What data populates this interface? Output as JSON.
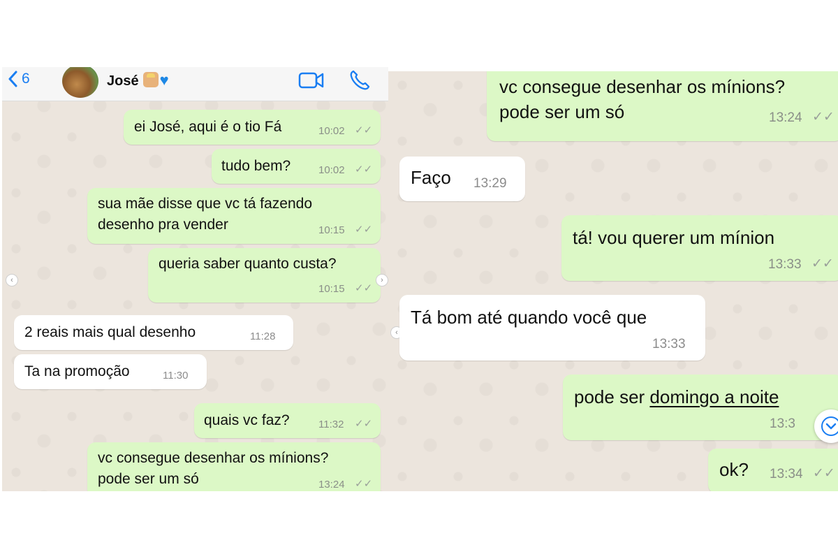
{
  "header": {
    "back_count": "6",
    "contact_name": "José",
    "icons": [
      "chevron-left-icon",
      "video-camera-icon",
      "phone-icon"
    ]
  },
  "left_chat": {
    "messages": [
      {
        "dir": "out",
        "text": "ei José, aqui é o tio Fá",
        "time": "10:02",
        "status": "read"
      },
      {
        "dir": "out",
        "text": "tudo bem?",
        "time": "10:02",
        "status": "read"
      },
      {
        "dir": "out",
        "text": "sua mãe disse que vc tá fazendo\ndesenho pra vender",
        "time": "10:15",
        "status": "read"
      },
      {
        "dir": "out",
        "text": "queria saber quanto custa?",
        "time": "10:15",
        "status": "read"
      },
      {
        "dir": "in",
        "text": "2 reais mais qual desenho",
        "time": "11:28"
      },
      {
        "dir": "in",
        "text": "Ta na promoção",
        "time": "11:30"
      },
      {
        "dir": "out",
        "text": "quais vc faz?",
        "time": "11:32",
        "status": "read"
      },
      {
        "dir": "out",
        "text": "vc consegue desenhar os mínions?\npode ser um só",
        "time": "13:24",
        "status": "read"
      }
    ]
  },
  "right_chat": {
    "messages": [
      {
        "dir": "out",
        "text": "vc consegue desenhar os mínions?\npode ser um só",
        "time": "13:24",
        "status": "read"
      },
      {
        "dir": "in",
        "text": "Faço",
        "time": "13:29"
      },
      {
        "dir": "out",
        "text": "tá! vou querer um mínion",
        "time": "13:33",
        "status": "read"
      },
      {
        "dir": "in",
        "text": "Tá bom até quando você que",
        "time": "13:33"
      },
      {
        "dir": "out",
        "text_prefix": "pode ser ",
        "text_link": "domingo a noite",
        "time": "13:3",
        "status": "read"
      },
      {
        "dir": "out",
        "text": "ok?",
        "time": "13:34",
        "status": "read"
      }
    ]
  },
  "glyphs": {
    "ticks": "✓✓",
    "nav_left": "‹",
    "nav_right": "›"
  },
  "colors": {
    "outgoing_bubble": "#dcf8c6",
    "incoming_bubble": "#ffffff",
    "chat_background": "#ece5dd",
    "ios_blue": "#1a7ef2"
  }
}
